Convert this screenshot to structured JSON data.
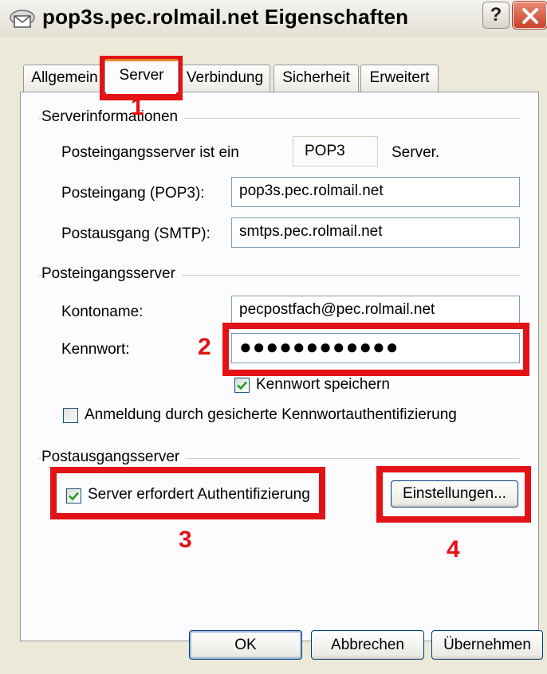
{
  "window": {
    "title": "pop3s.pec.rolmail.net Eigenschaften",
    "help_label": "?"
  },
  "tabs": [
    {
      "label": "Allgemein"
    },
    {
      "label": "Server"
    },
    {
      "label": "Verbindung"
    },
    {
      "label": "Sicherheit"
    },
    {
      "label": "Erweitert"
    }
  ],
  "server_info": {
    "heading": "Serverinformationen",
    "type_label": "Posteingangsserver ist ein",
    "type_value": "POP3",
    "type_suffix": "Server.",
    "incoming_label": "Posteingang (POP3):",
    "incoming_value": "pop3s.pec.rolmail.net",
    "outgoing_label": "Postausgang (SMTP):",
    "outgoing_value": "smtps.pec.rolmail.net"
  },
  "incoming_server": {
    "heading": "Posteingangsserver",
    "account_label": "Kontoname:",
    "account_value": "pecpostfach@pec.rolmail.net",
    "password_label": "Kennwort:",
    "password_value": "●●●●●●●●●●●●",
    "save_password_label": "Kennwort speichern",
    "save_password_checked": true,
    "spa_label": "Anmeldung durch gesicherte Kennwortauthentifizierung",
    "spa_checked": false
  },
  "outgoing_server": {
    "heading": "Postausgangsserver",
    "auth_label": "Server erfordert Authentifizierung",
    "auth_checked": true,
    "settings_button": "Einstellungen..."
  },
  "buttons": {
    "ok": "OK",
    "cancel": "Abbrechen",
    "apply": "Übernehmen"
  },
  "annotations": [
    "1",
    "2",
    "3",
    "4"
  ],
  "colors": {
    "highlight_red": "#e21216",
    "dialog_bg": "#ece9d8",
    "tab_accent": "#e68b2c",
    "checkmark_green": "#21a121"
  }
}
